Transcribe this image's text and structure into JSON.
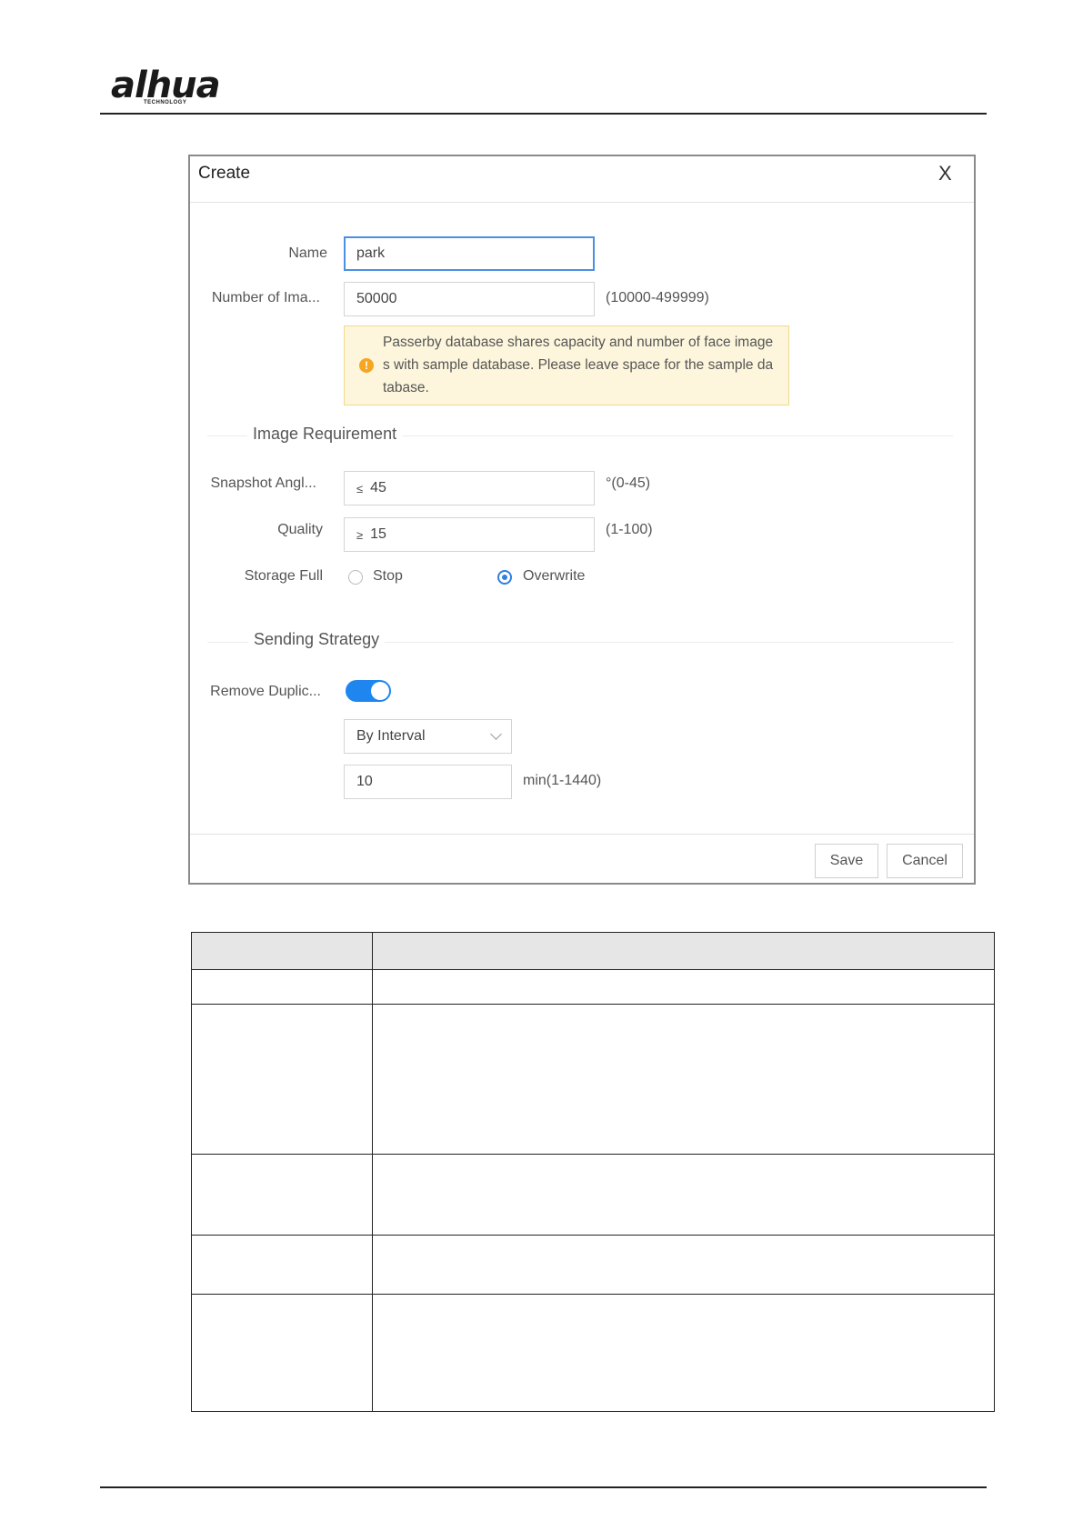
{
  "brand": {
    "logo_text": "alhua",
    "logo_sub": "TECHNOLOGY"
  },
  "dialog": {
    "title": "Create",
    "close_glyph": "X",
    "fields": {
      "name_label": "Name",
      "name_value": "park",
      "images_label": "Number of Ima...",
      "images_value": "50000",
      "images_range": "(10000-499999)",
      "notice": "Passerby database shares capacity and number of face image s with sample database. Please leave space for the sample da tabase."
    },
    "image_requirement": {
      "title": "Image Requirement",
      "snapshot_label": "Snapshot Angl...",
      "snapshot_prefix": "≤",
      "snapshot_value": "45",
      "snapshot_range": "°(0-45)",
      "quality_label": "Quality",
      "quality_prefix": "≥",
      "quality_value": "15",
      "quality_range": "(1-100)",
      "storage_label": "Storage Full",
      "option_stop": "Stop",
      "option_overwrite": "Overwrite",
      "selected": "Overwrite"
    },
    "sending_strategy": {
      "title": "Sending Strategy",
      "remove_label": "Remove Duplic...",
      "toggle_on": true,
      "mode_value": "By Interval",
      "interval_value": "10",
      "interval_range": "min(1-1440)"
    },
    "save_label": "Save",
    "cancel_label": "Cancel"
  },
  "colors": {
    "accent": "#1f86f0",
    "notice_bg": "#fdf6dc",
    "warning": "#f5a623"
  }
}
